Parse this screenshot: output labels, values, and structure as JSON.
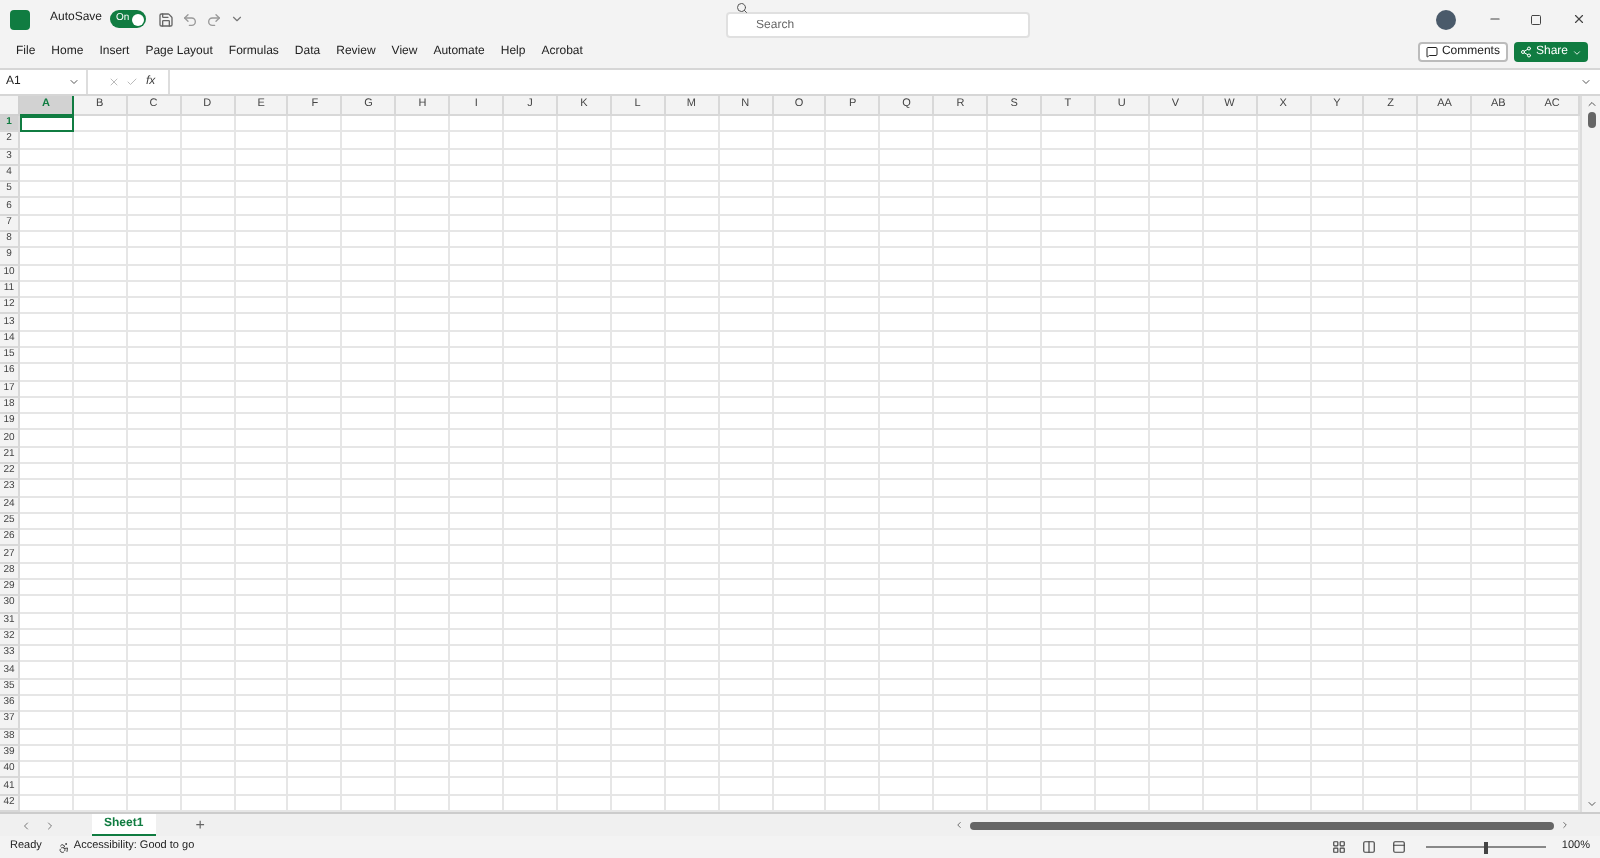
{
  "title_bar": {
    "autosave_label": "AutoSave",
    "autosave_toggle": {
      "label": "On",
      "on": true
    },
    "search": {
      "placeholder": "Search"
    }
  },
  "ribbon_tabs": [
    {
      "label": "File"
    },
    {
      "label": "Home"
    },
    {
      "label": "Insert"
    },
    {
      "label": "Page Layout"
    },
    {
      "label": "Formulas"
    },
    {
      "label": "Data"
    },
    {
      "label": "Review"
    },
    {
      "label": "View"
    },
    {
      "label": "Automate"
    },
    {
      "label": "Help"
    },
    {
      "label": "Acrobat"
    }
  ],
  "ribbon_buttons": {
    "comments": "Comments",
    "share": "Share"
  },
  "formula_bar": {
    "name_box": "A1",
    "function_label": "fx"
  },
  "columns": [
    {
      "label": "A",
      "selected": true
    },
    {
      "label": "B",
      "selected": false
    },
    {
      "label": "C",
      "selected": false
    },
    {
      "label": "D",
      "selected": false
    },
    {
      "label": "E",
      "selected": false
    },
    {
      "label": "F",
      "selected": false
    },
    {
      "label": "G",
      "selected": false
    },
    {
      "label": "H",
      "selected": false
    },
    {
      "label": "I",
      "selected": false
    },
    {
      "label": "J",
      "selected": false
    },
    {
      "label": "K",
      "selected": false
    },
    {
      "label": "L",
      "selected": false
    },
    {
      "label": "M",
      "selected": false
    },
    {
      "label": "N",
      "selected": false
    },
    {
      "label": "O",
      "selected": false
    },
    {
      "label": "P",
      "selected": false
    },
    {
      "label": "Q",
      "selected": false
    },
    {
      "label": "R",
      "selected": false
    },
    {
      "label": "S",
      "selected": false
    },
    {
      "label": "T",
      "selected": false
    },
    {
      "label": "U",
      "selected": false
    },
    {
      "label": "V",
      "selected": false
    },
    {
      "label": "W",
      "selected": false
    },
    {
      "label": "X",
      "selected": false
    },
    {
      "label": "Y",
      "selected": false
    },
    {
      "label": "Z",
      "selected": false
    },
    {
      "label": "AA",
      "selected": false
    },
    {
      "label": "AB",
      "selected": false
    },
    {
      "label": "AC",
      "selected": false
    }
  ],
  "rows": [
    {
      "label": "1",
      "selected": true
    },
    {
      "label": "2",
      "selected": false
    },
    {
      "label": "3",
      "selected": false
    },
    {
      "label": "4",
      "selected": false
    },
    {
      "label": "5",
      "selected": false
    },
    {
      "label": "6",
      "selected": false
    },
    {
      "label": "7",
      "selected": false
    },
    {
      "label": "8",
      "selected": false
    },
    {
      "label": "9",
      "selected": false
    },
    {
      "label": "10",
      "selected": false
    },
    {
      "label": "11",
      "selected": false
    },
    {
      "label": "12",
      "selected": false
    },
    {
      "label": "13",
      "selected": false
    },
    {
      "label": "14",
      "selected": false
    },
    {
      "label": "15",
      "selected": false
    },
    {
      "label": "16",
      "selected": false
    },
    {
      "label": "17",
      "selected": false
    },
    {
      "label": "18",
      "selected": false
    },
    {
      "label": "19",
      "selected": false
    },
    {
      "label": "20",
      "selected": false
    },
    {
      "label": "21",
      "selected": false
    },
    {
      "label": "22",
      "selected": false
    },
    {
      "label": "23",
      "selected": false
    },
    {
      "label": "24",
      "selected": false
    },
    {
      "label": "25",
      "selected": false
    },
    {
      "label": "26",
      "selected": false
    },
    {
      "label": "27",
      "selected": false
    },
    {
      "label": "28",
      "selected": false
    },
    {
      "label": "29",
      "selected": false
    },
    {
      "label": "30",
      "selected": false
    },
    {
      "label": "31",
      "selected": false
    },
    {
      "label": "32",
      "selected": false
    },
    {
      "label": "33",
      "selected": false
    },
    {
      "label": "34",
      "selected": false
    },
    {
      "label": "35",
      "selected": false
    },
    {
      "label": "36",
      "selected": false
    },
    {
      "label": "37",
      "selected": false
    },
    {
      "label": "38",
      "selected": false
    },
    {
      "label": "39",
      "selected": false
    },
    {
      "label": "40",
      "selected": false
    },
    {
      "label": "41",
      "selected": false
    },
    {
      "label": "42",
      "selected": false
    }
  ],
  "sheet_tabs": [
    {
      "label": "Sheet1",
      "selected": true
    }
  ],
  "add_sheet": "+",
  "status_bar": {
    "ready": "Ready",
    "accessibility": "Accessibility: Good to go",
    "zoom_slider": {
      "level": 0.5
    },
    "zoom": "100%"
  }
}
